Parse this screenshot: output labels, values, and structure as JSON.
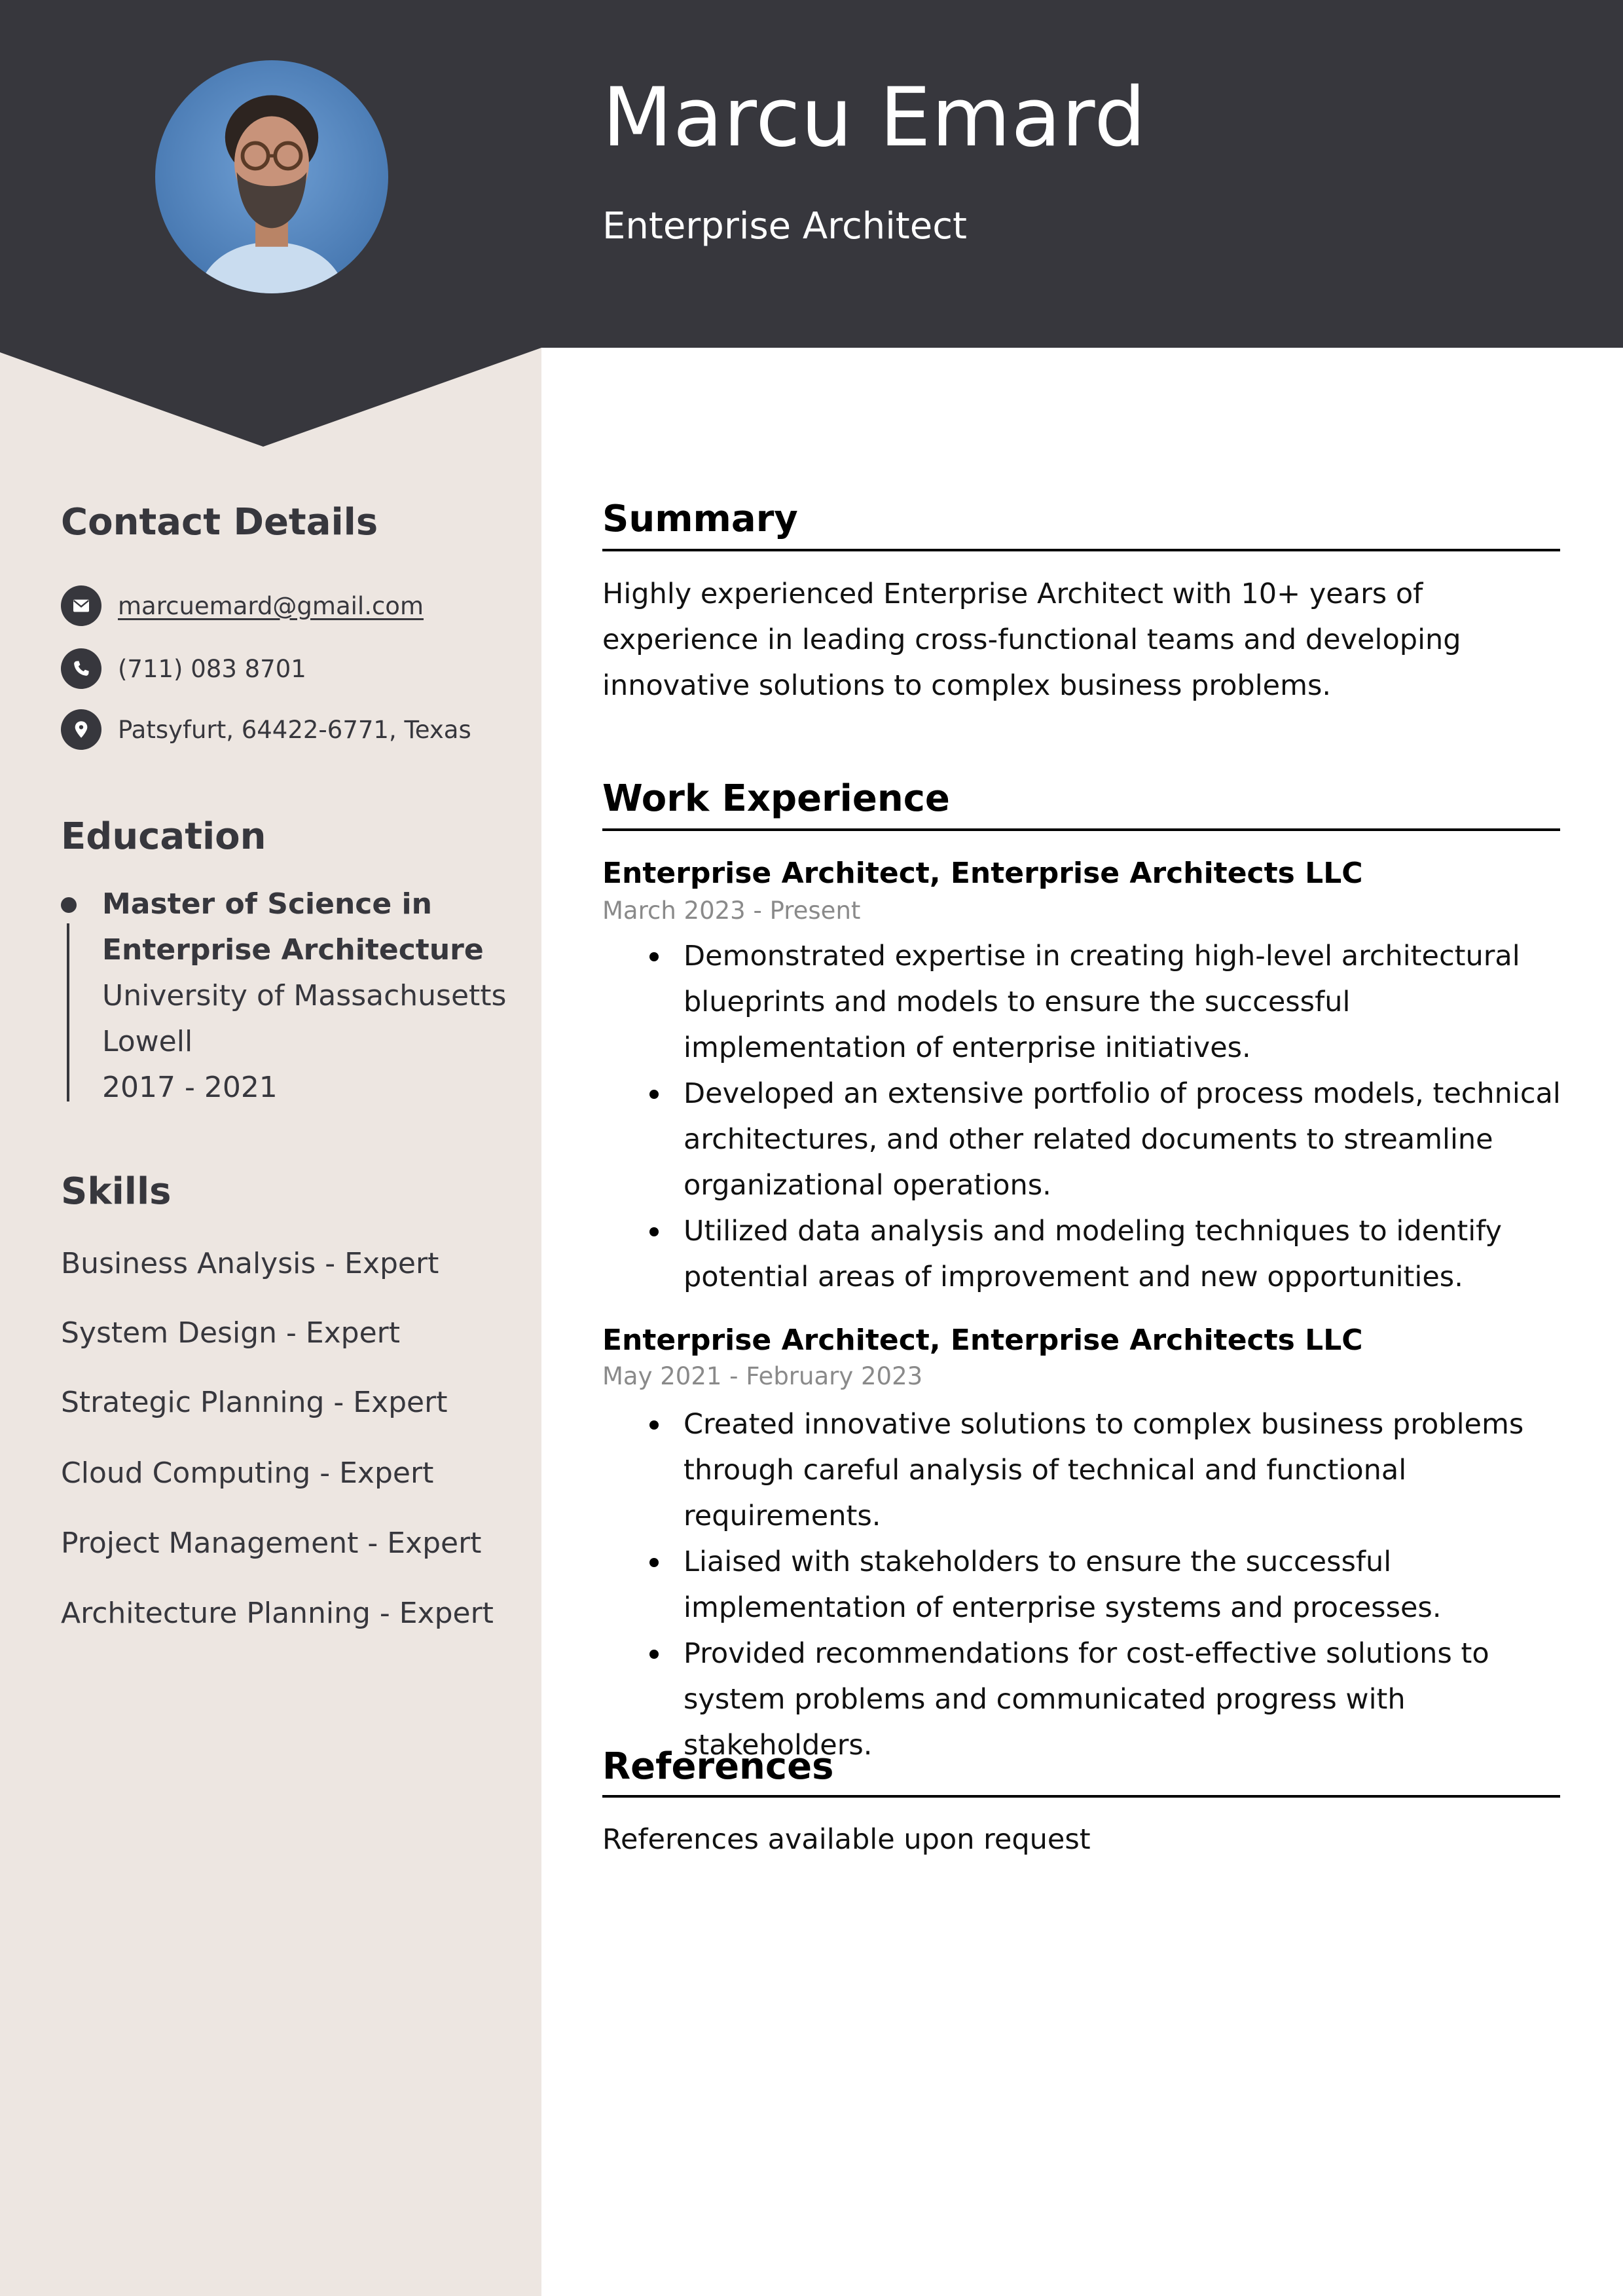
{
  "header": {
    "name": "Marcu Emard",
    "title": "Enterprise Architect",
    "photo_alt": "Portrait of Marcu Emard"
  },
  "colors": {
    "header_bg": "#37373d",
    "sidebar_bg": "#ede6e1",
    "accent_text": "#37373d",
    "date_gray": "#8a8a8a"
  },
  "sidebar": {
    "contact": {
      "heading": "Contact Details",
      "items": [
        {
          "icon": "envelope-icon",
          "text": "marcuemard@gmail.com",
          "is_link": true
        },
        {
          "icon": "phone-icon",
          "text": "(711) 083 8701",
          "is_link": false
        },
        {
          "icon": "location-pin-icon",
          "text": "Patsyfurt, 64422-6771, Texas",
          "is_link": false
        }
      ]
    },
    "education": {
      "heading": "Education",
      "items": [
        {
          "degree": "Master of Science in Enterprise Architecture",
          "school": "University of Massachusetts Lowell",
          "years": "2017 - 2021"
        }
      ]
    },
    "skills": {
      "heading": "Skills",
      "items": [
        "Business Analysis - Expert",
        "System Design - Expert",
        "Strategic Planning - Expert",
        "Cloud Computing - Expert",
        "Project Management - Expert",
        "Architecture Planning - Expert"
      ]
    }
  },
  "main": {
    "summary": {
      "heading": "Summary",
      "text": "Highly experienced Enterprise Architect with 10+ years of experience in leading cross-functional teams and developing innovative solutions to complex business problems."
    },
    "experience": {
      "heading": "Work Experience",
      "jobs": [
        {
          "title": "Enterprise Architect, Enterprise Architects LLC",
          "dates": "March 2023 - Present",
          "bullets": [
            "Demonstrated expertise in creating high-level architectural blueprints and models to ensure the successful implementation of enterprise initiatives.",
            "Developed an extensive portfolio of process models, technical architectures, and other related documents to streamline organizational operations.",
            "Utilized data analysis and modeling techniques to identify potential areas of improvement and new opportunities."
          ]
        },
        {
          "title": "Enterprise Architect, Enterprise Architects LLC",
          "dates": "May 2021 - February 2023",
          "bullets": [
            "Created innovative solutions to complex business problems through careful analysis of technical and functional requirements.",
            "Liaised with stakeholders to ensure the successful implementation of enterprise systems and processes.",
            "Provided recommendations for cost-effective solutions to system problems and communicated progress with stakeholders."
          ]
        }
      ]
    },
    "references": {
      "heading": "References",
      "text": "References available upon request"
    }
  }
}
